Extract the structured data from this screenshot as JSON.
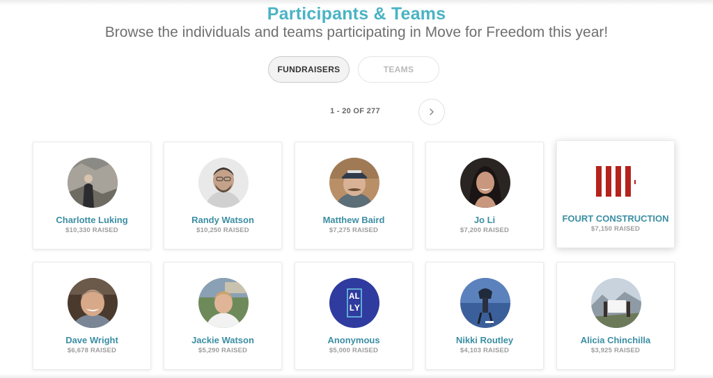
{
  "header": {
    "title": "Participants & Teams",
    "subtitle": "Browse the individuals and teams participating in Move for Freedom this year!"
  },
  "tabs": [
    {
      "label": "FUNDRAISERS",
      "active": true
    },
    {
      "label": "TEAMS",
      "active": false
    }
  ],
  "pagination": {
    "range_text": "1 - 20 OF 277",
    "next_icon": "chevron-right-icon"
  },
  "colors": {
    "accent": "#4ab3c4",
    "name_link": "#3b8ea3",
    "muted": "#9c9c9c"
  },
  "fundraisers": [
    {
      "name": "Charlotte Luking",
      "raised": "$10,330 RAISED"
    },
    {
      "name": "Randy Watson",
      "raised": "$10,250 RAISED"
    },
    {
      "name": "Matthew Baird",
      "raised": "$7,275 RAISED"
    },
    {
      "name": "Jo Li",
      "raised": "$7,200 RAISED"
    },
    {
      "name": "FOURT CONSTRUCTION",
      "raised": "$7,150 RAISED"
    },
    {
      "name": "Dave Wright",
      "raised": "$6,678 RAISED"
    },
    {
      "name": "Jackie Watson",
      "raised": "$5,290 RAISED"
    },
    {
      "name": "Anonymous",
      "raised": "$5,000 RAISED",
      "avatar_text": "ALLY"
    },
    {
      "name": "Nikki Routley",
      "raised": "$4,103 RAISED"
    },
    {
      "name": "Alicia Chinchilla",
      "raised": "$3,925 RAISED"
    }
  ]
}
